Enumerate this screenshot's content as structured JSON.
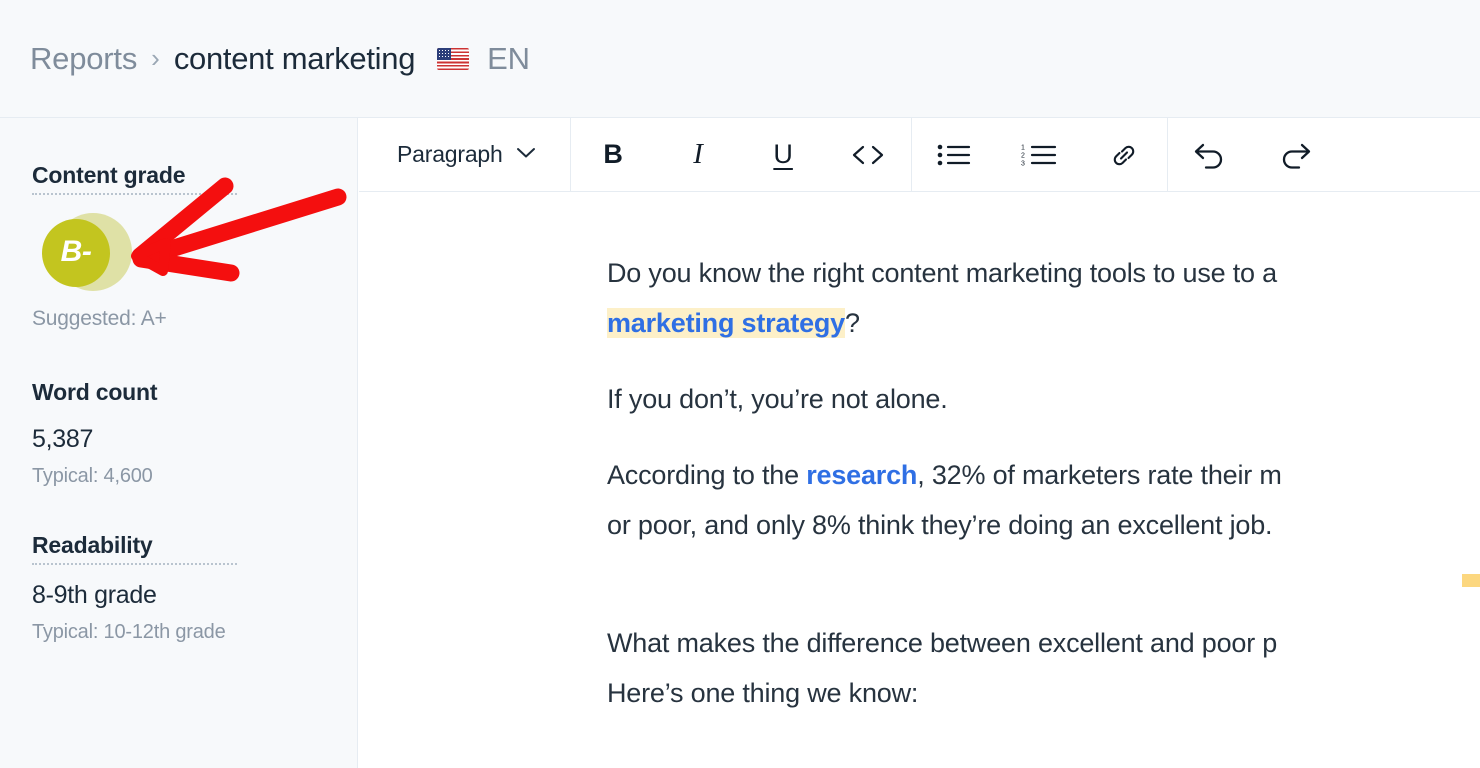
{
  "header": {
    "breadcrumb_parent": "Reports",
    "breadcrumb_separator": "›",
    "breadcrumb_current": "content marketing",
    "language_code": "EN",
    "flag_icon": "us-flag-icon"
  },
  "sidebar": {
    "content_grade": {
      "title": "Content grade",
      "grade": "B-",
      "suggested": "Suggested: A+",
      "badge_color": "#c3c51f",
      "badge_ring_color": "#dfe1a6"
    },
    "word_count": {
      "title": "Word count",
      "value": "5,387",
      "typical": "Typical: 4,600"
    },
    "readability": {
      "title": "Readability",
      "value": "8-9th grade",
      "typical": "Typical: 10-12th grade"
    }
  },
  "toolbar": {
    "paragraph_label": "Paragraph",
    "chevron_icon": "chevron-down-icon",
    "bold_label": "B",
    "italic_label": "I",
    "underline_label": "U",
    "code_label": "<>",
    "bullet_list_icon": "bullet-list-icon",
    "numbered_list_icon": "numbered-list-icon",
    "link_icon": "link-icon",
    "undo_icon": "undo-icon",
    "redo_icon": "redo-icon",
    "numbered_list_digits": [
      "1",
      "2",
      "3"
    ]
  },
  "document": {
    "paragraphs": [
      {
        "id": "p1",
        "segments": [
          {
            "text": "Do you know the right content marketing tools to use to a",
            "style": "plain"
          }
        ],
        "line2": [
          {
            "text": "marketing strategy",
            "style": "link-highlight"
          },
          {
            "text": "?",
            "style": "plain"
          }
        ]
      },
      {
        "id": "p2",
        "segments": [
          {
            "text": "If you don’t, you’re not alone.",
            "style": "plain"
          }
        ]
      },
      {
        "id": "p3",
        "segments": [
          {
            "text": "According to the ",
            "style": "plain"
          },
          {
            "text": "research",
            "style": "link"
          },
          {
            "text": ", 32% of marketers rate their m",
            "style": "plain"
          }
        ],
        "line2": [
          {
            "text": "or poor, and only 8% think they’re doing an excellent job.",
            "style": "plain"
          }
        ]
      },
      {
        "id": "p4",
        "segments": [
          {
            "text": "What makes the difference between excellent and poor p",
            "style": "plain"
          }
        ],
        "line2": [
          {
            "text": "Here’s one thing we know:",
            "style": "plain"
          }
        ]
      }
    ]
  },
  "annotation": {
    "arrow_color": "#f40f0f",
    "points_at": "content-grade-badge"
  }
}
